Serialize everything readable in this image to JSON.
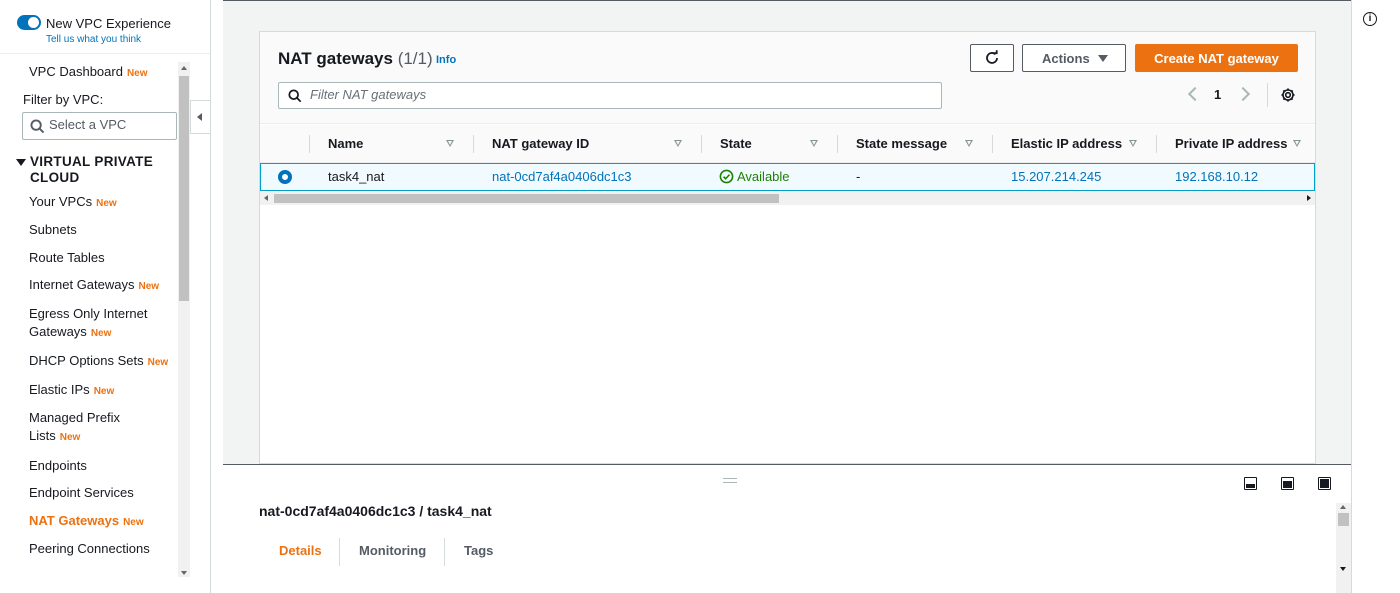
{
  "sidebar": {
    "experience_label": "New VPC Experience",
    "experience_feedback": "Tell us what you think",
    "dashboard": "VPC Dashboard",
    "new_badge": "New",
    "filter_label": "Filter by VPC:",
    "filter_placeholder": "Select a VPC",
    "section_title": "VIRTUAL PRIVATE CLOUD",
    "items": [
      {
        "label": "Your VPCs",
        "new": "New"
      },
      {
        "label": "Subnets",
        "new": ""
      },
      {
        "label": "Route Tables",
        "new": ""
      },
      {
        "label": "Internet Gateways",
        "new": "New"
      },
      {
        "label": "Egress Only Internet Gateways",
        "new": "New"
      },
      {
        "label": "DHCP Options Sets",
        "new": "New"
      },
      {
        "label": "Elastic IPs",
        "new": "New"
      },
      {
        "label": "Managed Prefix Lists",
        "new": "New"
      },
      {
        "label": "Endpoints",
        "new": ""
      },
      {
        "label": "Endpoint Services",
        "new": ""
      },
      {
        "label": "NAT Gateways",
        "new": "New",
        "active": true
      },
      {
        "label": "Peering Connections",
        "new": ""
      }
    ]
  },
  "header": {
    "title": "NAT gateways",
    "count": "(1/1)",
    "info": "Info",
    "actions_label": "Actions",
    "create_label": "Create NAT gateway",
    "search_placeholder": "Filter NAT gateways",
    "page": "1"
  },
  "table": {
    "columns": [
      "Name",
      "NAT gateway ID",
      "State",
      "State message",
      "Elastic IP address",
      "Private IP address"
    ],
    "rows": [
      {
        "name": "task4_nat",
        "id": "nat-0cd7af4a0406dc1c3",
        "state": "Available",
        "state_message": "-",
        "elastic_ip": "15.207.214.245",
        "private_ip": "192.168.10.12"
      }
    ]
  },
  "details": {
    "title": "nat-0cd7af4a0406dc1c3 / task4_nat",
    "tabs": [
      "Details",
      "Monitoring",
      "Tags"
    ]
  },
  "colors": {
    "accent": "#ec7211",
    "link": "#0073bb",
    "success": "#1d8102",
    "selected_row": "#f1faff"
  }
}
